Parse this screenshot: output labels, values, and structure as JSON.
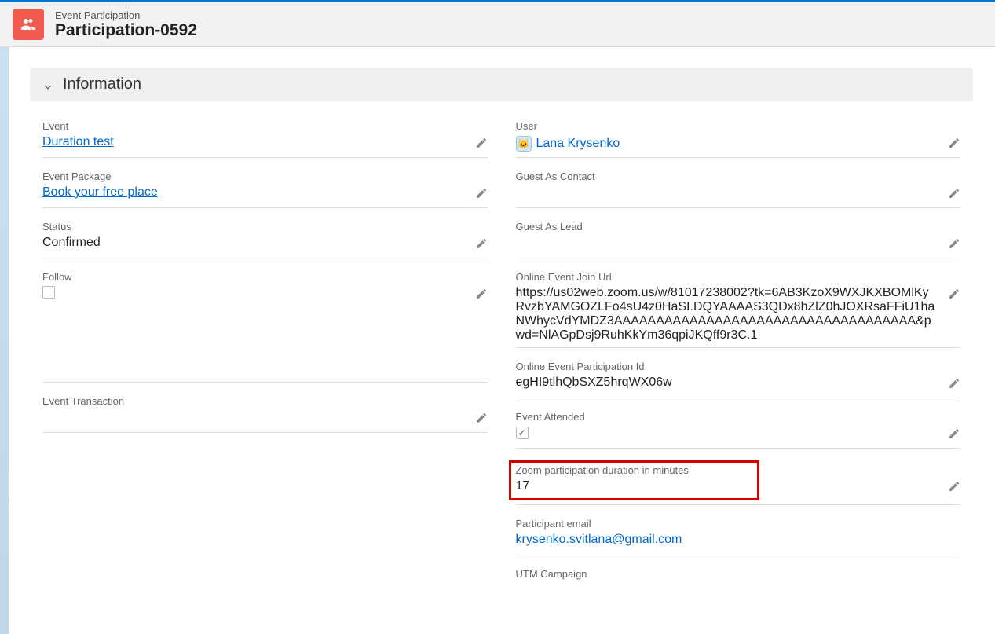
{
  "header": {
    "breadcrumb": "Event Participation",
    "title": "Participation-0592"
  },
  "section": {
    "title": "Information"
  },
  "left": {
    "event_label": "Event",
    "event_value": "Duration test",
    "event_package_label": "Event Package",
    "event_package_value": "Book your free place",
    "status_label": "Status",
    "status_value": "Confirmed",
    "follow_label": "Follow",
    "follow_checked": false,
    "event_transaction_label": "Event Transaction",
    "event_transaction_value": ""
  },
  "right": {
    "user_label": "User",
    "user_value": "Lana Krysenko",
    "guest_contact_label": "Guest As Contact",
    "guest_contact_value": "",
    "guest_lead_label": "Guest As Lead",
    "guest_lead_value": "",
    "join_url_label": "Online Event Join Url",
    "join_url_value": "https://us02web.zoom.us/w/81017238002?tk=6AB3KzoX9WXJKXBOMlKyRvzbYAMGOZLFo4sU4z0HaSI.DQYAAAAS3QDx8hZlZ0hJOXRsaFFiU1haNWhycVdYMDZ3AAAAAAAAAAAAAAAAAAAAAAAAAAAAAAAAAAAA&pwd=NlAGpDsj9RuhKkYm36qpiJKQff9r3C.1",
    "participation_id_label": "Online Event Participation Id",
    "participation_id_value": "egHI9tlhQbSXZ5hrqWX06w",
    "attended_label": "Event Attended",
    "attended_checked": true,
    "duration_label": "Zoom participation duration in minutes",
    "duration_value": "17",
    "email_label": "Participant email",
    "email_value": "krysenko.svitlana@gmail.com",
    "utm_campaign_label": "UTM Campaign",
    "utm_campaign_value": ""
  }
}
